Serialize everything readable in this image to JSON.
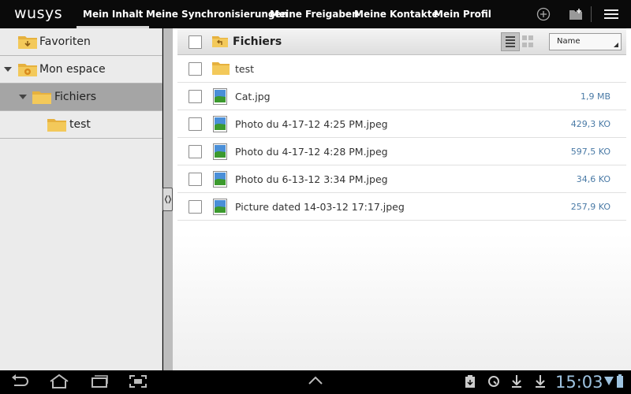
{
  "app": {
    "logo": "wusys"
  },
  "nav": {
    "tabs": [
      {
        "label": "Mein Inhalt",
        "active": true
      },
      {
        "label": "Meine Synchronisierungen",
        "active": false
      },
      {
        "label": "Meine Freigaben",
        "active": false
      },
      {
        "label": "Meine Kontakte",
        "active": false
      },
      {
        "label": "Mein Profil",
        "active": false
      }
    ],
    "icons": [
      "add-circle-icon",
      "new-folder-icon",
      "menu-icon"
    ]
  },
  "sidebar": {
    "items": [
      {
        "label": "Favoriten",
        "icon": "favorites-folder-icon",
        "expanded": false,
        "selected": false
      },
      {
        "label": "Mon espace",
        "icon": "space-folder-icon",
        "expanded": true,
        "selected": false
      },
      {
        "label": "Fichiers",
        "icon": "folder-icon",
        "expanded": true,
        "selected": true
      },
      {
        "label": "test",
        "icon": "folder-icon",
        "expanded": false,
        "selected": false
      }
    ]
  },
  "list": {
    "header": {
      "title": "Fichiers",
      "sort_value": "Name"
    },
    "rows": [
      {
        "name": "test",
        "size": "",
        "type": "folder"
      },
      {
        "name": "Cat.jpg",
        "size": "1,9 MB",
        "type": "image"
      },
      {
        "name": "Photo du 4-17-12 4:25 PM.jpeg",
        "size": "429,3 KO",
        "type": "image"
      },
      {
        "name": "Photo du 4-17-12 4:28 PM.jpeg",
        "size": "597,5 KO",
        "type": "image"
      },
      {
        "name": "Photo du 6-13-12 3:34 PM.jpeg",
        "size": "34,6 KO",
        "type": "image"
      },
      {
        "name": "Picture dated 14-03-12 17:17.jpeg",
        "size": "257,9 KO",
        "type": "image"
      }
    ]
  },
  "system": {
    "clock": "15:03",
    "colors": {
      "accent": "#9ec3e0",
      "size_text": "#4a7aa6"
    }
  }
}
